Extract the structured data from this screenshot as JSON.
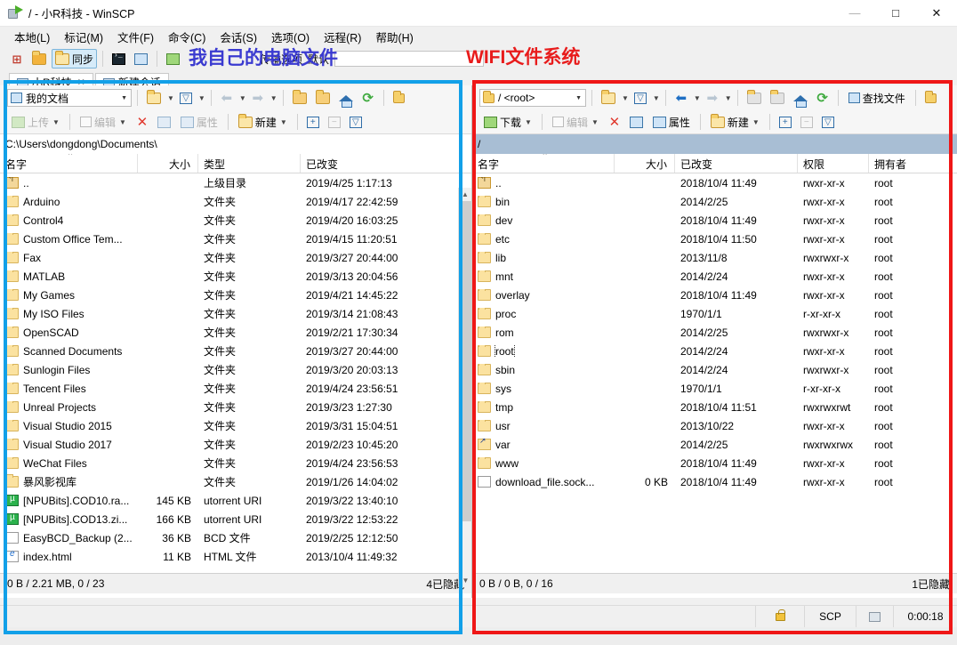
{
  "window": {
    "title": "/ - 小R科技 - WinSCP",
    "app_icon": "winscp-icon",
    "minimize": "—",
    "maximize": "□",
    "close": "✕"
  },
  "menubar": {
    "items": [
      {
        "label": "本地(L)",
        "name": "menu-local"
      },
      {
        "label": "标记(M)",
        "name": "menu-mark"
      },
      {
        "label": "文件(F)",
        "name": "menu-file"
      },
      {
        "label": "命令(C)",
        "name": "menu-command"
      },
      {
        "label": "会话(S)",
        "name": "menu-session"
      },
      {
        "label": "选项(O)",
        "name": "menu-options"
      },
      {
        "label": "远程(R)",
        "name": "menu-remote"
      },
      {
        "label": "帮助(H)",
        "name": "menu-help"
      }
    ]
  },
  "toolbar": {
    "sync_label": "同步",
    "transfer_label": "传输选项",
    "transfer_value": "默认"
  },
  "annotations": {
    "blue": "我自己的电脑文件",
    "red": "WIFI文件系统"
  },
  "tabs": [
    {
      "label": "小R科技",
      "close": "✕",
      "active": true
    },
    {
      "label": "新建会话",
      "close": "",
      "active": false
    }
  ],
  "left_pane": {
    "location_combo": "我的文档",
    "path": "C:\\Users\\dongdong\\Documents\\",
    "buttons": {
      "upload": "上传",
      "edit": "编辑",
      "properties": "属性",
      "new": "新建"
    },
    "columns": [
      {
        "label": "名字",
        "key": "name"
      },
      {
        "label": "大小",
        "key": "size"
      },
      {
        "label": "类型",
        "key": "type"
      },
      {
        "label": "已改变",
        "key": "modified"
      }
    ],
    "sort_indicator": "^",
    "rows": [
      {
        "icon": "up-folder-icon",
        "name": "..",
        "size": "",
        "type": "上级目录",
        "modified": "2019/4/25  1:17:13"
      },
      {
        "icon": "folder-icon",
        "name": "Arduino",
        "size": "",
        "type": "文件夹",
        "modified": "2019/4/17  22:42:59"
      },
      {
        "icon": "folder-icon",
        "name": "Control4",
        "size": "",
        "type": "文件夹",
        "modified": "2019/4/20  16:03:25"
      },
      {
        "icon": "folder-icon",
        "name": "Custom Office Tem...",
        "size": "",
        "type": "文件夹",
        "modified": "2019/4/15  11:20:51"
      },
      {
        "icon": "folder-icon",
        "name": "Fax",
        "size": "",
        "type": "文件夹",
        "modified": "2019/3/27  20:44:00"
      },
      {
        "icon": "folder-icon",
        "name": "MATLAB",
        "size": "",
        "type": "文件夹",
        "modified": "2019/3/13  20:04:56"
      },
      {
        "icon": "folder-icon",
        "name": "My Games",
        "size": "",
        "type": "文件夹",
        "modified": "2019/4/21  14:45:22"
      },
      {
        "icon": "folder-icon",
        "name": "My ISO Files",
        "size": "",
        "type": "文件夹",
        "modified": "2019/3/14  21:08:43"
      },
      {
        "icon": "folder-icon",
        "name": "OpenSCAD",
        "size": "",
        "type": "文件夹",
        "modified": "2019/2/21  17:30:34"
      },
      {
        "icon": "folder-icon",
        "name": "Scanned Documents",
        "size": "",
        "type": "文件夹",
        "modified": "2019/3/27  20:44:00"
      },
      {
        "icon": "folder-icon",
        "name": "Sunlogin Files",
        "size": "",
        "type": "文件夹",
        "modified": "2019/3/20  20:03:13"
      },
      {
        "icon": "folder-icon",
        "name": "Tencent Files",
        "size": "",
        "type": "文件夹",
        "modified": "2019/4/24  23:56:51"
      },
      {
        "icon": "folder-icon",
        "name": "Unreal Projects",
        "size": "",
        "type": "文件夹",
        "modified": "2019/3/23  1:27:30"
      },
      {
        "icon": "folder-icon",
        "name": "Visual Studio 2015",
        "size": "",
        "type": "文件夹",
        "modified": "2019/3/31  15:04:51"
      },
      {
        "icon": "folder-icon",
        "name": "Visual Studio 2017",
        "size": "",
        "type": "文件夹",
        "modified": "2019/2/23  10:45:20"
      },
      {
        "icon": "folder-icon",
        "name": "WeChat Files",
        "size": "",
        "type": "文件夹",
        "modified": "2019/4/24  23:56:53"
      },
      {
        "icon": "folder-icon",
        "name": "暴风影视库",
        "size": "",
        "type": "文件夹",
        "modified": "2019/1/26  14:04:02"
      },
      {
        "icon": "utorrent-icon",
        "name": "[NPUBits].COD10.ra...",
        "size": "145 KB",
        "type": "utorrent URI",
        "modified": "2019/3/22  13:40:10"
      },
      {
        "icon": "utorrent-icon",
        "name": "[NPUBits].COD13.zi...",
        "size": "166 KB",
        "type": "utorrent URI",
        "modified": "2019/3/22  12:53:22"
      },
      {
        "icon": "doc-icon",
        "name": "EasyBCD_Backup (2...",
        "size": "36 KB",
        "type": "BCD 文件",
        "modified": "2019/2/25  12:12:50"
      },
      {
        "icon": "html-icon",
        "name": "index.html",
        "size": "11 KB",
        "type": "HTML 文件",
        "modified": "2013/10/4  11:49:32"
      }
    ],
    "status": {
      "summary": "0 B / 2.21 MB,  0 / 23",
      "hidden": "4已隐藏"
    }
  },
  "right_pane": {
    "location_combo": "/ <root>",
    "path": "/",
    "buttons": {
      "download": "下载",
      "edit": "编辑",
      "properties": "属性",
      "new": "新建",
      "find": "查找文件"
    },
    "columns": [
      {
        "label": "名字",
        "key": "name"
      },
      {
        "label": "大小",
        "key": "size"
      },
      {
        "label": "已改变",
        "key": "modified"
      },
      {
        "label": "权限",
        "key": "perm"
      },
      {
        "label": "拥有者",
        "key": "owner"
      }
    ],
    "sort_indicator": "^",
    "rows": [
      {
        "icon": "up-folder-icon",
        "name": "..",
        "size": "",
        "modified": "2018/10/4 11:49",
        "perm": "rwxr-xr-x",
        "owner": "root",
        "focused": false
      },
      {
        "icon": "folder-icon",
        "name": "bin",
        "size": "",
        "modified": "2014/2/25",
        "perm": "rwxr-xr-x",
        "owner": "root",
        "focused": false
      },
      {
        "icon": "folder-icon",
        "name": "dev",
        "size": "",
        "modified": "2018/10/4 11:49",
        "perm": "rwxr-xr-x",
        "owner": "root",
        "focused": false
      },
      {
        "icon": "folder-icon",
        "name": "etc",
        "size": "",
        "modified": "2018/10/4 11:50",
        "perm": "rwxr-xr-x",
        "owner": "root",
        "focused": false
      },
      {
        "icon": "folder-icon",
        "name": "lib",
        "size": "",
        "modified": "2013/11/8",
        "perm": "rwxrwxr-x",
        "owner": "root",
        "focused": false
      },
      {
        "icon": "folder-icon",
        "name": "mnt",
        "size": "",
        "modified": "2014/2/24",
        "perm": "rwxr-xr-x",
        "owner": "root",
        "focused": false
      },
      {
        "icon": "folder-icon",
        "name": "overlay",
        "size": "",
        "modified": "2018/10/4 11:49",
        "perm": "rwxr-xr-x",
        "owner": "root",
        "focused": false
      },
      {
        "icon": "folder-icon",
        "name": "proc",
        "size": "",
        "modified": "1970/1/1",
        "perm": "r-xr-xr-x",
        "owner": "root",
        "focused": false
      },
      {
        "icon": "folder-icon",
        "name": "rom",
        "size": "",
        "modified": "2014/2/25",
        "perm": "rwxrwxr-x",
        "owner": "root",
        "focused": false
      },
      {
        "icon": "folder-icon",
        "name": "root",
        "size": "",
        "modified": "2014/2/24",
        "perm": "rwxr-xr-x",
        "owner": "root",
        "focused": true
      },
      {
        "icon": "folder-icon",
        "name": "sbin",
        "size": "",
        "modified": "2014/2/24",
        "perm": "rwxrwxr-x",
        "owner": "root",
        "focused": false
      },
      {
        "icon": "folder-icon",
        "name": "sys",
        "size": "",
        "modified": "1970/1/1",
        "perm": "r-xr-xr-x",
        "owner": "root",
        "focused": false
      },
      {
        "icon": "folder-icon",
        "name": "tmp",
        "size": "",
        "modified": "2018/10/4 11:51",
        "perm": "rwxrwxrwt",
        "owner": "root",
        "focused": false
      },
      {
        "icon": "folder-icon",
        "name": "usr",
        "size": "",
        "modified": "2013/10/22",
        "perm": "rwxr-xr-x",
        "owner": "root",
        "focused": false
      },
      {
        "icon": "symlink-icon",
        "name": "var",
        "size": "",
        "modified": "2014/2/25",
        "perm": "rwxrwxrwx",
        "owner": "root",
        "focused": false
      },
      {
        "icon": "folder-icon",
        "name": "www",
        "size": "",
        "modified": "2018/10/4 11:49",
        "perm": "rwxr-xr-x",
        "owner": "root",
        "focused": false
      },
      {
        "icon": "doc-icon",
        "name": "download_file.sock...",
        "size": "0 KB",
        "modified": "2018/10/4 11:49",
        "perm": "rwxr-xr-x",
        "owner": "root",
        "focused": false
      }
    ],
    "status": {
      "summary": "0 B / 0 B,  0 / 16",
      "hidden": "1已隐藏"
    }
  },
  "app_status": {
    "lock_icon": "lock-icon",
    "protocol": "SCP",
    "session_icon": "session-icon",
    "duration": "0:00:18"
  }
}
